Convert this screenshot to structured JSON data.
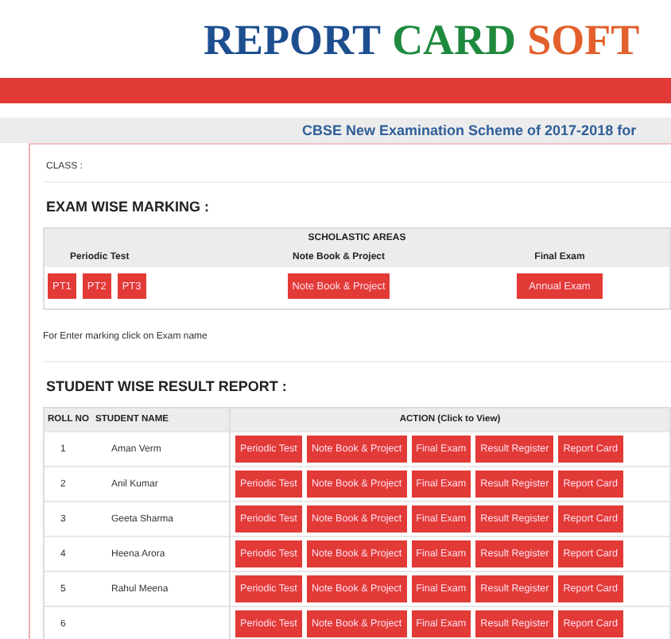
{
  "header": {
    "title_parts": [
      {
        "text": "REPORT",
        "color": "#1d4f8f"
      },
      {
        "text": "CARD",
        "color": "#1f8a3e"
      },
      {
        "text": "SOFT",
        "color": "#e2602b"
      }
    ]
  },
  "scheme_bar": {
    "text": "CBSE New Examination Scheme of 2017-2018 for"
  },
  "class_label": "CLASS :",
  "exam_marking": {
    "heading": "EXAM WISE MARKING :",
    "table_title": "SCHOLASTIC AREAS",
    "groups": [
      {
        "label": "Periodic Test",
        "buttons": [
          "PT1",
          "PT2",
          "PT3"
        ]
      },
      {
        "label": "Note Book & Project",
        "buttons": [
          "Note Book & Project"
        ]
      },
      {
        "label": "Final Exam",
        "buttons": [
          "Annual Exam"
        ]
      }
    ]
  },
  "note": "For Enter marking click on Exam name",
  "result_report": {
    "heading": "STUDENT WISE RESULT REPORT :",
    "columns": [
      "ROLL NO",
      "STUDENT NAME",
      "ACTION (Click to View)"
    ],
    "rows": [
      {
        "roll": "1",
        "name": "Aman Verm",
        "actions": [
          "Periodic Test",
          "Note Book & Project",
          "Final Exam",
          "Result Register",
          "Report Card"
        ]
      },
      {
        "roll": "2",
        "name": "Anil Kumar",
        "actions": [
          "Periodic Test",
          "Note Book & Project",
          "Final Exam",
          "Result Register",
          "Report Card"
        ]
      },
      {
        "roll": "3",
        "name": "Geeta Sharma",
        "actions": [
          "Periodic Test",
          "Note Book & Project",
          "Final Exam",
          "Result Register",
          "Report Card"
        ]
      },
      {
        "roll": "4",
        "name": "Heena Arora",
        "actions": [
          "Periodic Test",
          "Note Book & Project",
          "Final Exam",
          "Result Register",
          "Report Card"
        ]
      },
      {
        "roll": "5",
        "name": "Rahul Meena",
        "actions": [
          "Periodic Test",
          "Note Book & Project",
          "Final Exam",
          "Result Register",
          "Report Card"
        ]
      },
      {
        "roll": "6",
        "actions": [
          "Periodic Test",
          "Note Book & Project",
          "Final Exam",
          "Result Register",
          "Report Card"
        ]
      }
    ]
  }
}
